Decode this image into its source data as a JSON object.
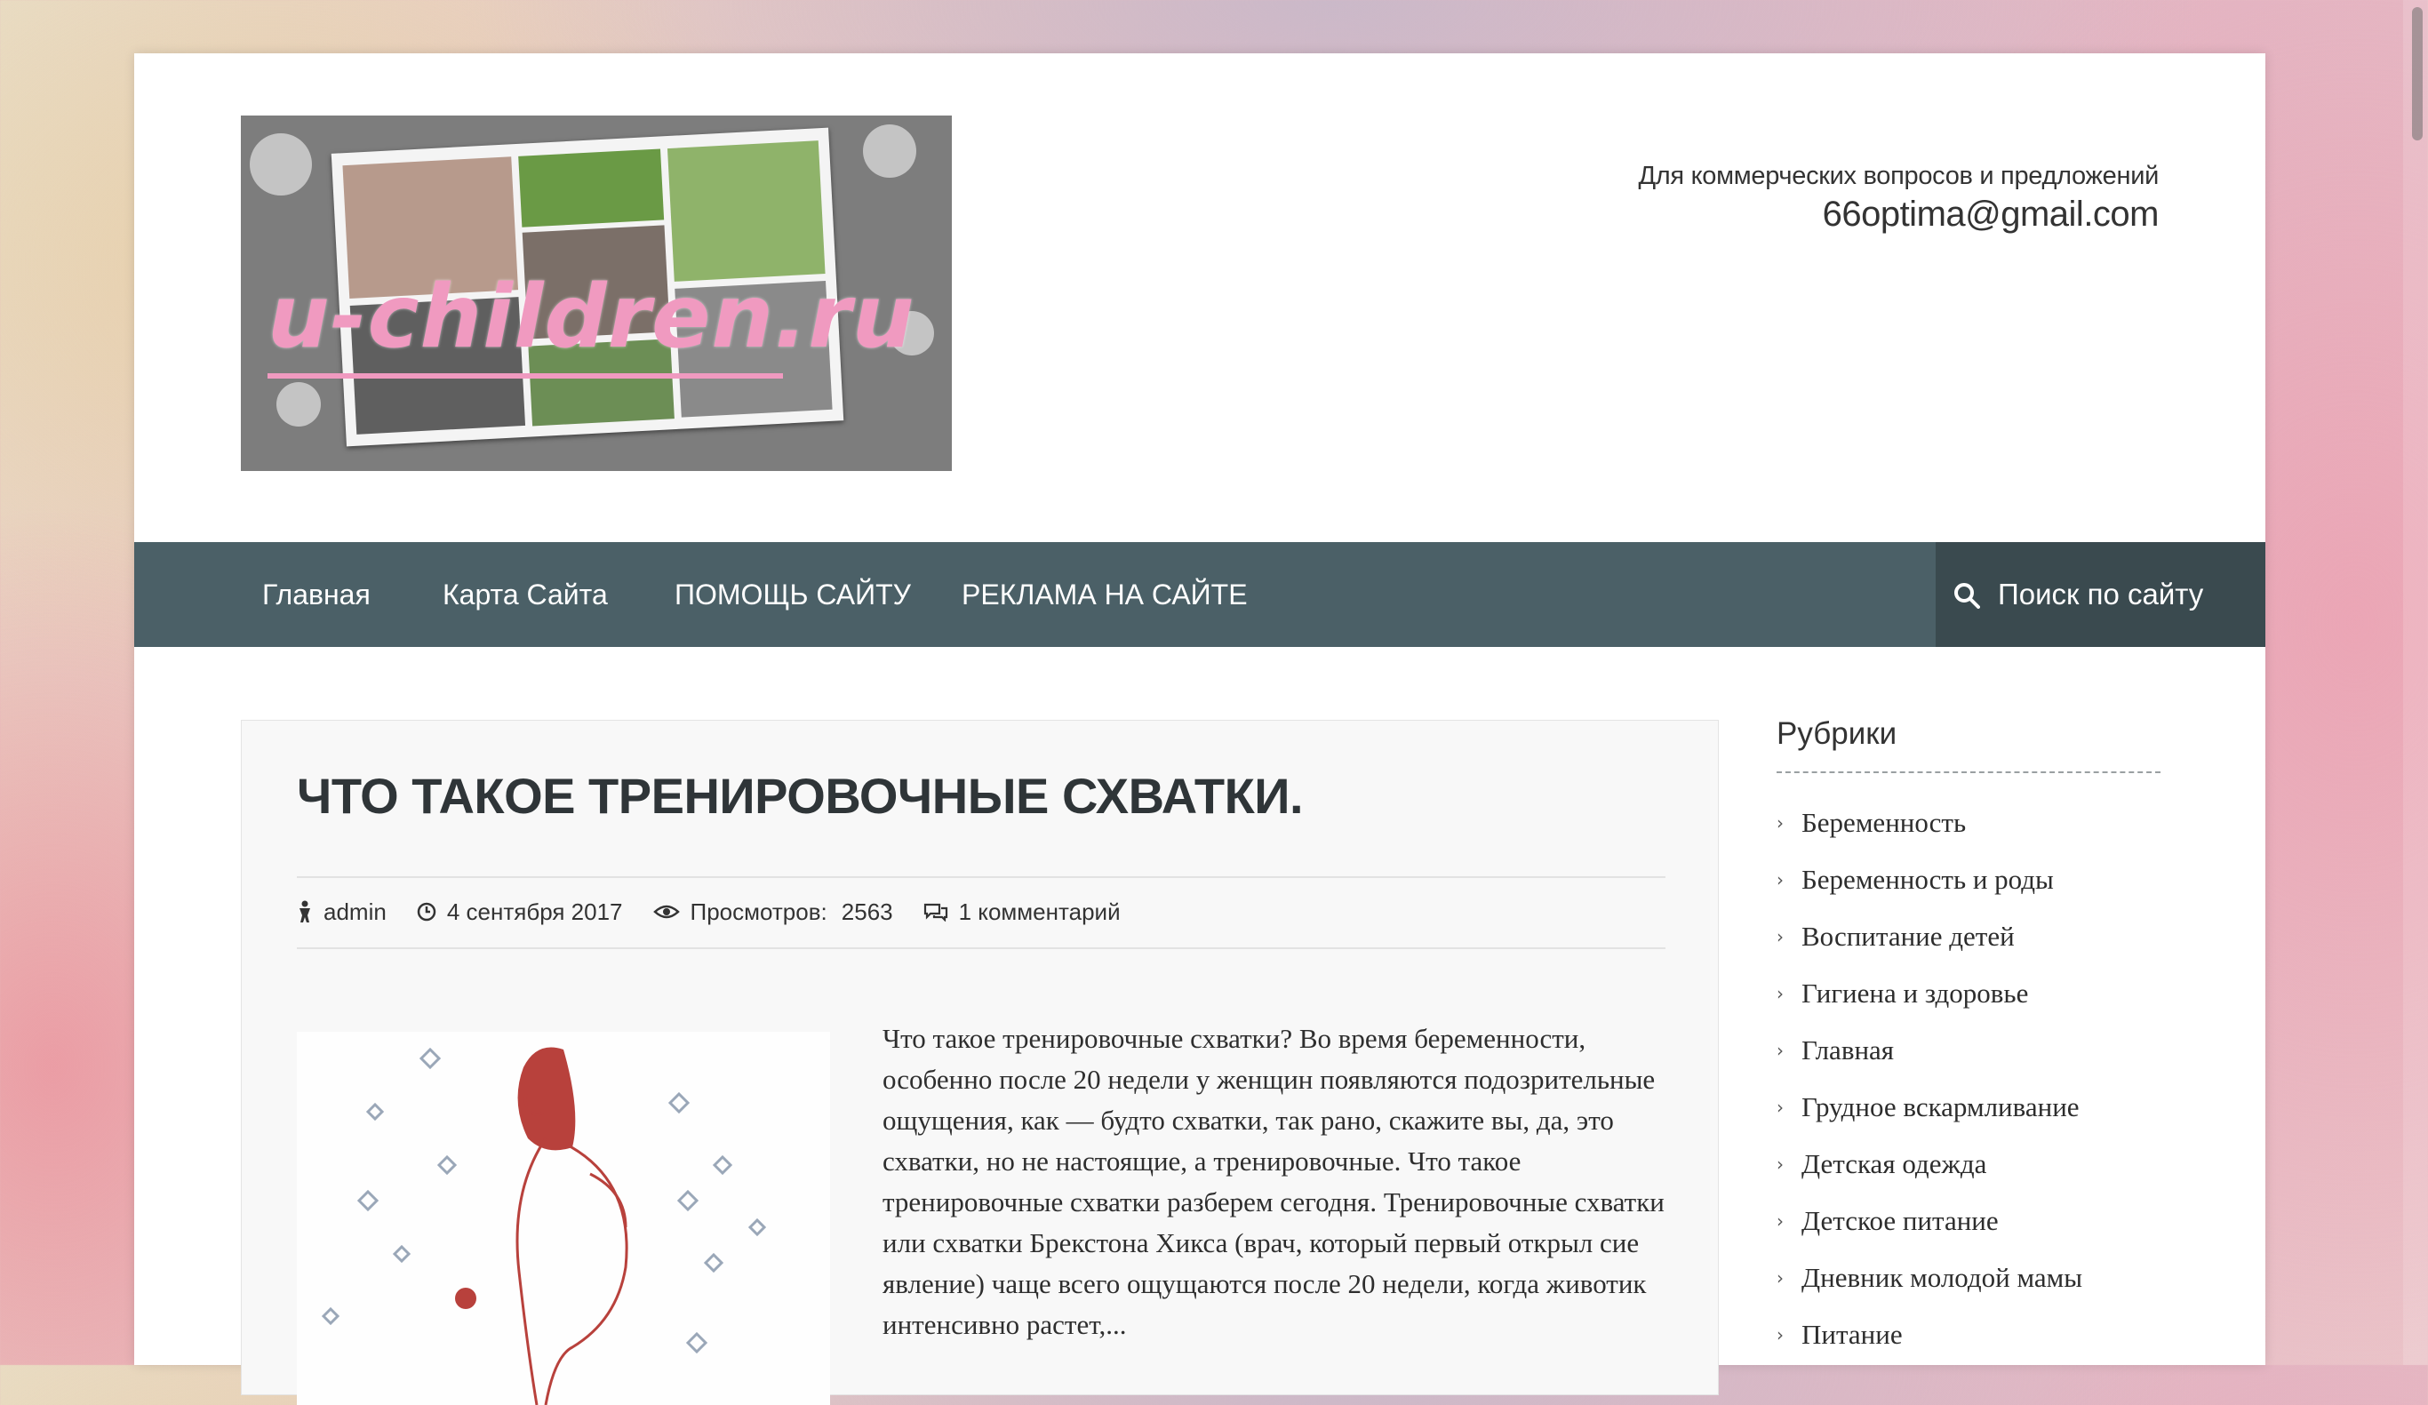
{
  "header": {
    "logo_text": "u-children.ru",
    "contact_label": "Для коммерческих вопросов и предложений",
    "contact_email": "66optima@gmail.com"
  },
  "nav": {
    "items": [
      {
        "label": "Главная"
      },
      {
        "label": "Карта Сайта"
      },
      {
        "label": "ПОМОЩЬ САЙТУ"
      },
      {
        "label": "РЕКЛАМА НА САЙТЕ"
      }
    ],
    "search_label": "Поиск по сайту",
    "search_icon": "search-icon"
  },
  "article": {
    "title": "ЧТО ТАКОЕ ТРЕНИРОВОЧНЫЕ СХВАТКИ.",
    "meta": {
      "author": "admin",
      "date": "4 сентября 2017",
      "views_label": "Просмотров:",
      "views": "2563",
      "comments": "1 комментарий"
    },
    "excerpt": "Что такое тренировочные схватки? Во время беременности, особенно после 20 недели у женщин появляются подозрительные ощущения, как — будто схватки, так рано, скажите вы, да, это схватки, но не настоящие, а тренировочные. Что такое тренировочные схватки разберем сегодня. Тренировочные схватки или схватки Брекстона Хикса (врач, который первый открыл сие явление) чаще всего ощущаются после 20 недели, когда животик интенсивно растет,..."
  },
  "sidebar": {
    "title": "Рубрики",
    "items": [
      "Беременность",
      "Беременность и роды",
      "Воспитание детей",
      "Гигиена и здоровье",
      "Главная",
      "Грудное вскармливание",
      "Детская одежда",
      "Детское питание",
      "Дневник молодой мамы",
      "Питание"
    ]
  },
  "colors": {
    "nav_bg": "#4b6067",
    "search_bg": "#3a4a4f",
    "logo_text": "#f09ac0"
  }
}
